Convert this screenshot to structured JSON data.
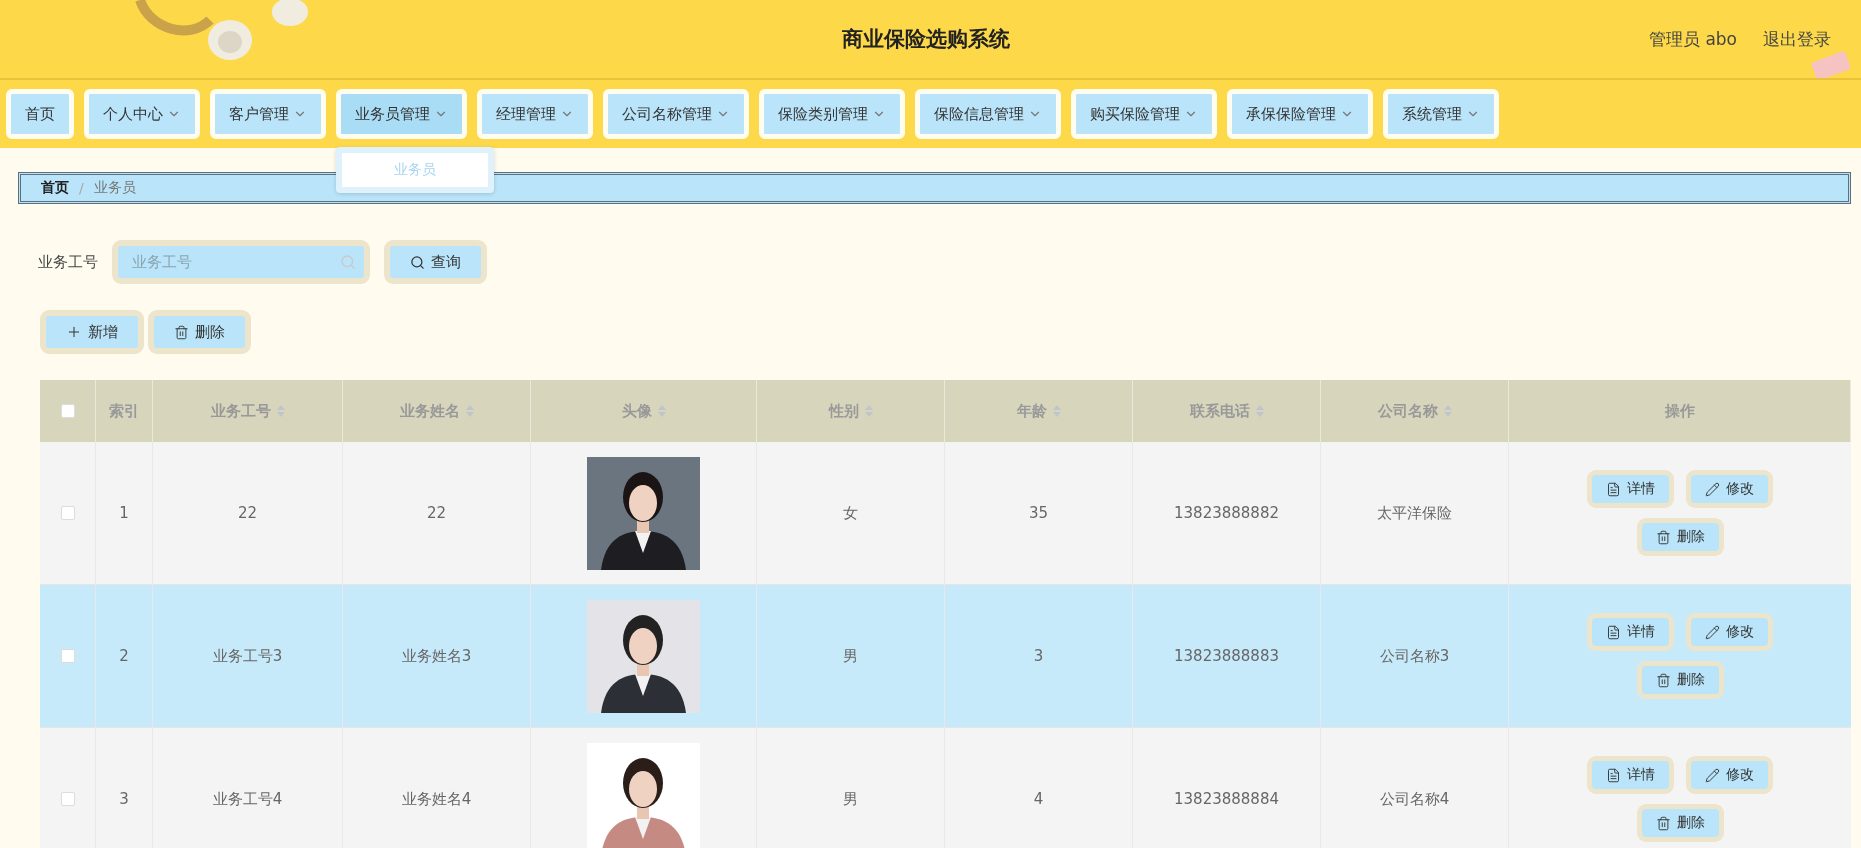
{
  "header": {
    "title": "商业保险选购系统",
    "user": "管理员 abo",
    "logout": "退出登录"
  },
  "nav": [
    {
      "label": "首页",
      "has_menu": false,
      "expanded": false
    },
    {
      "label": "个人中心",
      "has_menu": true,
      "expanded": false
    },
    {
      "label": "客户管理",
      "has_menu": true,
      "expanded": false
    },
    {
      "label": "业务员管理",
      "has_menu": true,
      "expanded": true,
      "menu_items": [
        "业务员"
      ]
    },
    {
      "label": "经理管理",
      "has_menu": true,
      "expanded": false
    },
    {
      "label": "公司名称管理",
      "has_menu": true,
      "expanded": false
    },
    {
      "label": "保险类别管理",
      "has_menu": true,
      "expanded": false
    },
    {
      "label": "保险信息管理",
      "has_menu": true,
      "expanded": false
    },
    {
      "label": "购买保险管理",
      "has_menu": true,
      "expanded": false
    },
    {
      "label": "承保保险管理",
      "has_menu": true,
      "expanded": false
    },
    {
      "label": "系统管理",
      "has_menu": true,
      "expanded": false
    }
  ],
  "breadcrumb_separator": "/",
  "breadcrumb": [
    {
      "label": "首页",
      "current": false
    },
    {
      "label": "业务员",
      "current": true
    }
  ],
  "search": {
    "label": "业务工号",
    "placeholder": "业务工号",
    "button": "查询"
  },
  "actions": [
    {
      "kind": "add",
      "label": "新增"
    },
    {
      "kind": "delete",
      "label": "删除"
    }
  ],
  "table": {
    "select_all_checked": false,
    "columns": [
      {
        "label": "索引"
      },
      {
        "label": "业务工号",
        "sortable": true
      },
      {
        "label": "业务姓名",
        "sortable": true
      },
      {
        "label": "头像",
        "sortable": true
      },
      {
        "label": "性别",
        "sortable": true
      },
      {
        "label": "年龄",
        "sortable": true
      },
      {
        "label": "联系电话",
        "sortable": true
      },
      {
        "label": "公司名称",
        "sortable": true
      },
      {
        "label": "操作"
      }
    ],
    "rows": [
      {
        "checked": false,
        "selected": false,
        "index": "1",
        "id": "22",
        "name": "22",
        "gender": "女",
        "age": "35",
        "phone": "13823888882",
        "company": "太平洋保险",
        "actions": [
          {
            "kind": "detail",
            "label": "详情"
          },
          {
            "kind": "edit",
            "label": "修改"
          },
          {
            "kind": "delete",
            "label": "删除"
          }
        ]
      },
      {
        "checked": false,
        "selected": true,
        "index": "2",
        "id": "业务工号3",
        "name": "业务姓名3",
        "gender": "男",
        "age": "3",
        "phone": "13823888883",
        "company": "公司名称3",
        "actions": [
          {
            "kind": "detail",
            "label": "详情"
          },
          {
            "kind": "edit",
            "label": "修改"
          },
          {
            "kind": "delete",
            "label": "删除"
          }
        ]
      },
      {
        "checked": false,
        "selected": false,
        "index": "3",
        "id": "业务工号4",
        "name": "业务姓名4",
        "gender": "男",
        "age": "4",
        "phone": "13823888884",
        "company": "公司名称4",
        "actions": [
          {
            "kind": "detail",
            "label": "详情"
          },
          {
            "kind": "edit",
            "label": "修改"
          },
          {
            "kind": "delete",
            "label": "删除"
          }
        ]
      }
    ]
  }
}
